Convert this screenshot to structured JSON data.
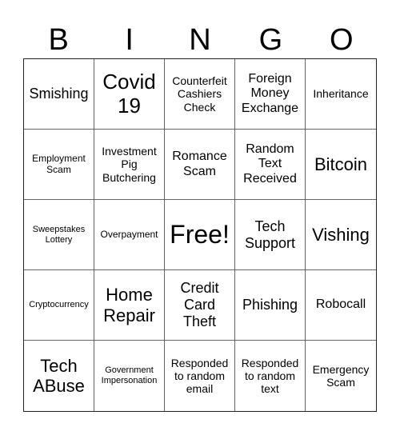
{
  "header": {
    "letters": [
      "B",
      "I",
      "N",
      "G",
      "O"
    ]
  },
  "board": {
    "cells": [
      {
        "text": "Smishing",
        "size": "s-xl"
      },
      {
        "text": "Covid\n19",
        "size": "s-xxxl"
      },
      {
        "text": "Counterfeit\nCashiers\nCheck",
        "size": "s-md"
      },
      {
        "text": "Foreign\nMoney\nExchange",
        "size": "s-lg"
      },
      {
        "text": "Inheritance",
        "size": "s-md"
      },
      {
        "text": "Employment\nScam",
        "size": "s-sm"
      },
      {
        "text": "Investment\nPig\nButchering",
        "size": "s-md"
      },
      {
        "text": "Romance\nScam",
        "size": "s-lg"
      },
      {
        "text": "Random\nText\nReceived",
        "size": "s-lg"
      },
      {
        "text": "Bitcoin",
        "size": "s-xxl"
      },
      {
        "text": "Sweepstakes\nLottery",
        "size": "s-xs"
      },
      {
        "text": "Overpayment",
        "size": "s-sm"
      },
      {
        "text": "Free!",
        "size": "s-free",
        "free": true
      },
      {
        "text": "Tech\nSupport",
        "size": "s-xl"
      },
      {
        "text": "Vishing",
        "size": "s-xxl"
      },
      {
        "text": "Cryptocurrency",
        "size": "s-xs"
      },
      {
        "text": "Home\nRepair",
        "size": "s-xxl"
      },
      {
        "text": "Credit\nCard\nTheft",
        "size": "s-xl"
      },
      {
        "text": "Phishing",
        "size": "s-xl"
      },
      {
        "text": "Robocall",
        "size": "s-lg"
      },
      {
        "text": "Tech\nABuse",
        "size": "s-xxl"
      },
      {
        "text": "Government\nImpersonation",
        "size": "s-xs"
      },
      {
        "text": "Responded\nto random\nemail",
        "size": "s-md"
      },
      {
        "text": "Responded\nto random\ntext",
        "size": "s-md"
      },
      {
        "text": "Emergency\nScam",
        "size": "s-md"
      }
    ]
  }
}
